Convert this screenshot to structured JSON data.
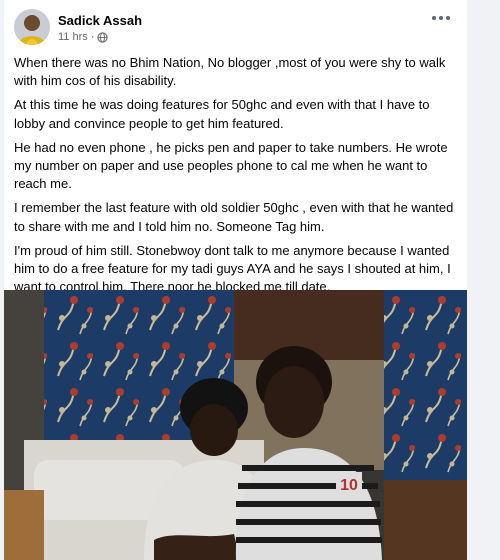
{
  "post": {
    "author": "Sadick Assah",
    "time": "11 hrs",
    "separator": "·",
    "privacy_icon": "globe-icon",
    "more_icon": "more-options-icon",
    "paragraphs": [
      "When there was no Bhim Nation, No blogger ,most of you were shy to walk with him cos of his disability.",
      "At this time he was doing features for 50ghc and even with that I have to lobby and convince people to get him featured.",
      "He had no even phone , he picks pen and paper to take numbers. He wrote my number on paper and use peoples phone to cal me when he want to reach me.",
      "I remember the last feature with old soldier 50ghc , even with that he wanted to share with me and I told him no. Someone Tag him.",
      "I'm proud of him still. Stonebwoy dont talk to me anymore because I wanted him to do a free feature for my tadi guys AYA and he says I shouted at him, I want to control him. There noor he blocked me till date."
    ],
    "photo": {
      "shirt_number": "10"
    }
  },
  "colors": {
    "background": "#f0f2f5",
    "card": "#ffffff",
    "text": "#050505",
    "secondary_text": "#65676b"
  }
}
